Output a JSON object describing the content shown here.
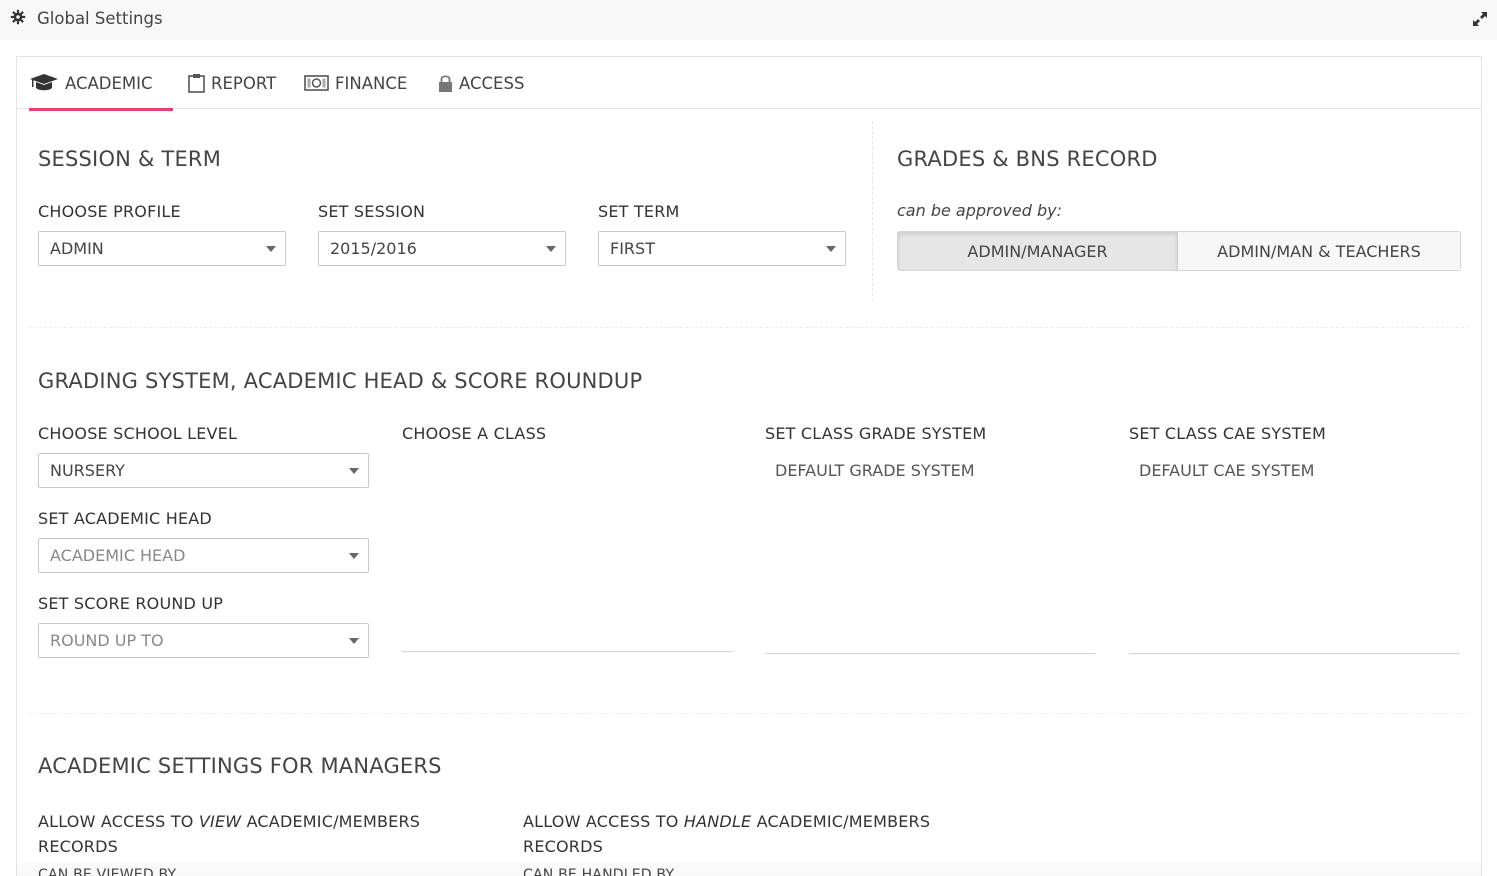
{
  "window": {
    "title": "Global Settings",
    "icon": "gear-icon",
    "expand_icon": "expand-icon"
  },
  "tabs": [
    {
      "label": "ACADEMIC",
      "icon": "graduation-cap-icon",
      "active": true
    },
    {
      "label": "REPORT",
      "icon": "clipboard-icon",
      "active": false
    },
    {
      "label": "FINANCE",
      "icon": "money-icon",
      "active": false
    },
    {
      "label": "ACCESS",
      "icon": "lock-icon",
      "active": false
    }
  ],
  "session_term": {
    "title": "SESSION & TERM",
    "profile": {
      "label": "CHOOSE PROFILE",
      "value": "ADMIN"
    },
    "session": {
      "label": "SET SESSION",
      "value": "2015/2016"
    },
    "term": {
      "label": "SET TERM",
      "value": "FIRST"
    }
  },
  "grades": {
    "title": "GRADES & BNS RECORD",
    "note": "can be approved by:",
    "options": [
      "ADMIN/MANAGER",
      "ADMIN/MAN & TEACHERS"
    ],
    "selected": "ADMIN/MANAGER"
  },
  "grading": {
    "title": "GRADING SYSTEM, ACADEMIC HEAD & SCORE ROUNDUP",
    "school_level": {
      "label": "CHOOSE SCHOOL LEVEL",
      "value": "NURSERY"
    },
    "academic_head": {
      "label": "SET ACADEMIC HEAD",
      "placeholder": "ACADEMIC HEAD"
    },
    "score_roundup": {
      "label": "SET SCORE ROUND UP",
      "placeholder": "ROUND UP TO"
    },
    "class": {
      "label": "CHOOSE A CLASS"
    },
    "grade_system": {
      "label": "SET CLASS GRADE SYSTEM",
      "value": "DEFAULT GRADE SYSTEM"
    },
    "cae_system": {
      "label": "SET CLASS CAE SYSTEM",
      "value": "DEFAULT CAE SYSTEM"
    }
  },
  "managers": {
    "title": "ACADEMIC SETTINGS FOR MANAGERS",
    "view": {
      "prefix": "ALLOW ACCESS TO ",
      "emph": "VIEW",
      "suffix": " ACADEMIC/MEMBERS",
      "line2": "RECORDS",
      "sub": "CAN BE VIEWED BY"
    },
    "handle": {
      "prefix": "ALLOW ACCESS TO ",
      "emph": "HANDLE",
      "suffix": " ACADEMIC/MEMBERS",
      "line2": "RECORDS",
      "sub": "CAN BE HANDLED BY"
    }
  },
  "colors": {
    "accent": "#e83e72"
  }
}
